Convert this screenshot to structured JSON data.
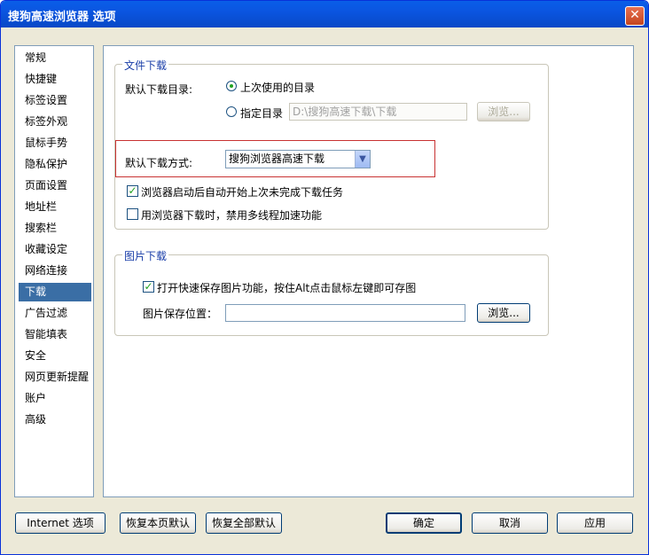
{
  "window": {
    "title": "搜狗高速浏览器 选项",
    "close_glyph": "✕"
  },
  "sidebar": {
    "items": [
      {
        "label": "常规"
      },
      {
        "label": "快捷键"
      },
      {
        "label": "标签设置"
      },
      {
        "label": "标签外观"
      },
      {
        "label": "鼠标手势"
      },
      {
        "label": "隐私保护"
      },
      {
        "label": "页面设置"
      },
      {
        "label": "地址栏"
      },
      {
        "label": "搜索栏"
      },
      {
        "label": "收藏设定"
      },
      {
        "label": "网络连接"
      },
      {
        "label": "下载"
      },
      {
        "label": "广告过滤"
      },
      {
        "label": "智能填表"
      },
      {
        "label": "安全"
      },
      {
        "label": "网页更新提醒"
      },
      {
        "label": "账户"
      },
      {
        "label": "高级"
      }
    ],
    "selected": "下载"
  },
  "file_download": {
    "legend": "文件下载",
    "default_dir_label": "默认下载目录:",
    "radio_last_used": "上次使用的目录",
    "radio_specify": "指定目录",
    "dir_value": "D:\\搜狗高速下载\\下载",
    "browse_label": "浏览...",
    "method_label": "默认下载方式:",
    "method_value": "搜狗浏览器高速下载",
    "checkbox_resume": "浏览器启动后自动开始上次未完成下载任务",
    "checkbox_disable_multithread": "用浏览器下载时，禁用多线程加速功能"
  },
  "image_download": {
    "legend": "图片下载",
    "checkbox_quick_save": "打开快速保存图片功能，按住Alt点击鼠标左键即可存图",
    "save_location_label": "图片保存位置：",
    "save_location_value": "",
    "browse_label": "浏览..."
  },
  "footer": {
    "internet_options": "Internet 选项",
    "restore_page": "恢复本页默认",
    "restore_all": "恢复全部默认",
    "ok": "确定",
    "cancel": "取消",
    "apply": "应用"
  },
  "colors": {
    "title_bar": "#0a5ee8",
    "selected_item": "#3a6ea5",
    "highlight_box": "#c83232"
  }
}
